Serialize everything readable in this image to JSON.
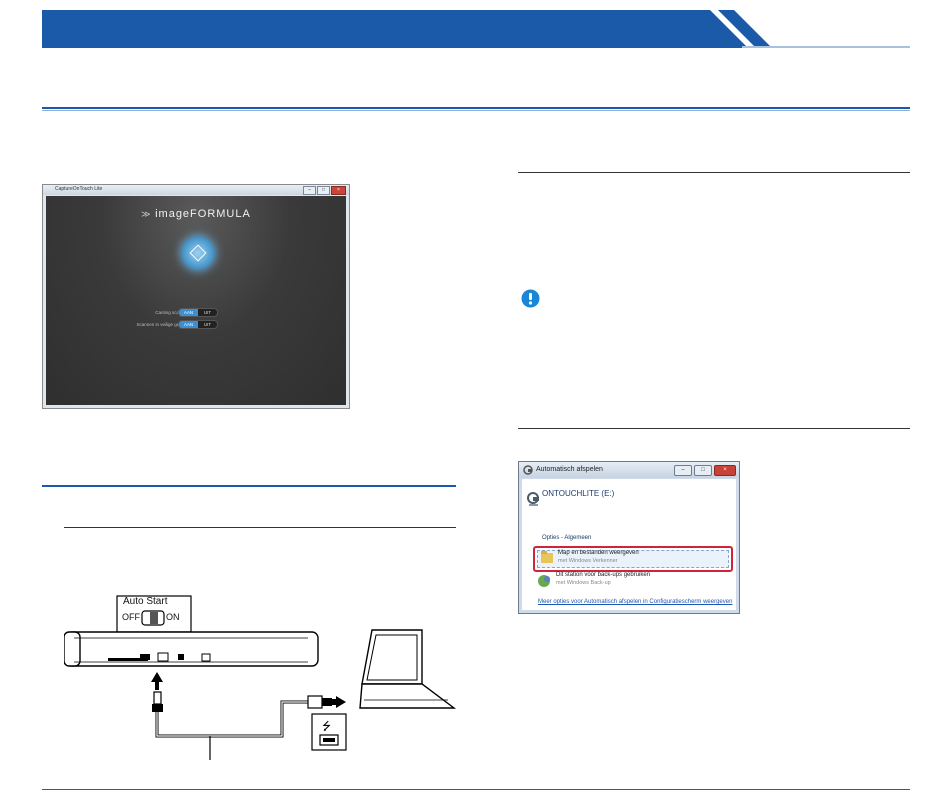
{
  "cot_window": {
    "title": "CaptureOnTouch Lite",
    "logo": "imageFORMULA",
    "rows": [
      {
        "label": "Canting scannen inschakelen",
        "on": "AAN",
        "off": "UIT"
      },
      {
        "label": "Scannen in veilige gebruikelijke modus",
        "on": "AAN",
        "off": "UIT"
      }
    ]
  },
  "autoplay_window": {
    "title": "Automatisch afspelen",
    "drive": "ONTOUCHLITE (E:)",
    "section": "Opties - Algemeen",
    "option1_main": "Map en bestanden weergeven",
    "option1_sub": "met Windows Verkenner",
    "option2_main": "Dit station voor back-ups gebruiken",
    "option2_sub": "met Windows Back-up",
    "more_link": "Meer opties voor Automatisch afspelen in Configuratiescherm weergeven"
  },
  "scanner": {
    "switch_title": "Auto Start",
    "off_label": "OFF",
    "on_label": "ON"
  },
  "colors": {
    "banner": "#1b5aa8",
    "notice": "#1a86d8",
    "highlight": "#d0243a"
  }
}
